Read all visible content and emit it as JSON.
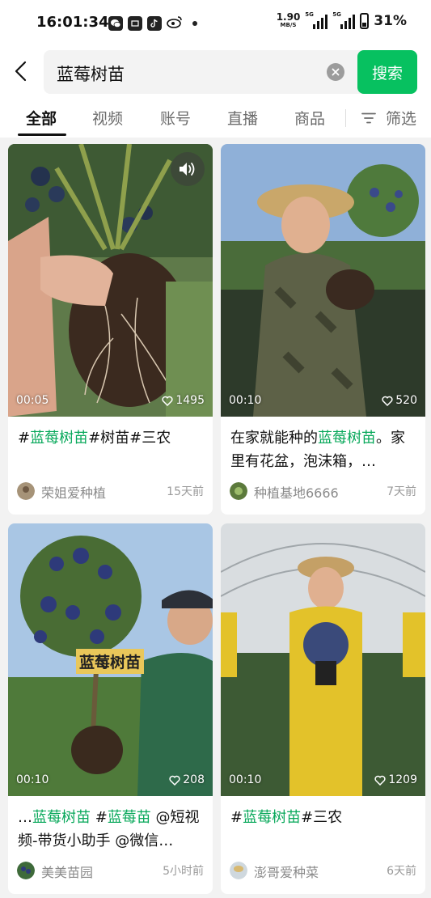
{
  "status_bar": {
    "time": "16:01:34",
    "app_icons": [
      "wechat-icon",
      "soul-icon",
      "tiktok-icon",
      "weibo-icon"
    ],
    "net_speed": "1.90",
    "net_unit": "MB/S",
    "signal_label_1": "5G",
    "signal_label_2": "5G",
    "battery": "31%"
  },
  "search": {
    "query": "蓝莓树苗",
    "button_label": "搜索"
  },
  "tabs": {
    "items": [
      "全部",
      "视频",
      "账号",
      "直播",
      "商品"
    ],
    "active_index": 0,
    "filter_label": "筛选"
  },
  "colors": {
    "accent": "#07c160",
    "highlight": "#07a85a",
    "background": "#f2f2f2"
  },
  "cards": [
    {
      "duration": "00:05",
      "likes": "1495",
      "has_mute_icon": true,
      "title_parts": [
        {
          "text": "#",
          "hl": false
        },
        {
          "text": "蓝莓树苗",
          "hl": true
        },
        {
          "text": "#树苗#三农",
          "hl": false
        }
      ],
      "author": "荣姐爱种植",
      "time": "15天前"
    },
    {
      "duration": "00:10",
      "likes": "520",
      "title_parts": [
        {
          "text": "在家就能种的",
          "hl": false
        },
        {
          "text": "蓝莓树苗",
          "hl": true
        },
        {
          "text": "。家里有花盆，泡沫箱，…",
          "hl": false
        }
      ],
      "author": "种植基地6666",
      "time": "7天前"
    },
    {
      "duration": "00:10",
      "likes": "208",
      "video_caption": "蓝莓树苗",
      "title_parts": [
        {
          "text": "…",
          "hl": false
        },
        {
          "text": "蓝莓树苗",
          "hl": true
        },
        {
          "text": " #",
          "hl": false
        },
        {
          "text": "蓝莓苗",
          "hl": true
        },
        {
          "text": " @短视频-带货小助手 @微信…",
          "hl": false
        }
      ],
      "author": "美美苗园",
      "time": "5小时前"
    },
    {
      "duration": "00:10",
      "likes": "1209",
      "title_parts": [
        {
          "text": "#",
          "hl": false
        },
        {
          "text": "蓝莓树苗",
          "hl": true
        },
        {
          "text": "#三农",
          "hl": false
        }
      ],
      "author": "澎哥爱种菜",
      "time": "6天前"
    }
  ]
}
